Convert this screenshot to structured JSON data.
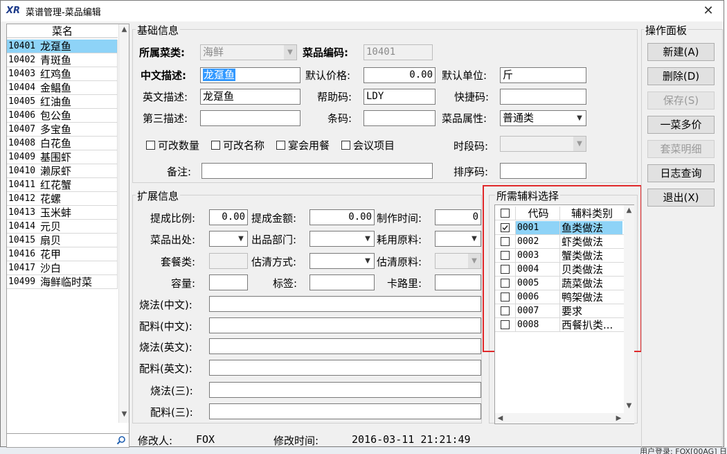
{
  "window": {
    "title": "菜谱管理-菜品编辑",
    "logo_text": "XR",
    "close_glyph": "✕"
  },
  "dish_list": {
    "header": "菜名",
    "rows": [
      {
        "code": "10401",
        "name": "龙趸鱼",
        "selected": true
      },
      {
        "code": "10402",
        "name": "青斑鱼"
      },
      {
        "code": "10403",
        "name": "红鸡鱼"
      },
      {
        "code": "10404",
        "name": "金鲳鱼"
      },
      {
        "code": "10405",
        "name": "红油鱼"
      },
      {
        "code": "10406",
        "name": "包公鱼"
      },
      {
        "code": "10407",
        "name": "多宝鱼"
      },
      {
        "code": "10408",
        "name": "白花鱼"
      },
      {
        "code": "10409",
        "name": "基围虾"
      },
      {
        "code": "10410",
        "name": "濑尿虾"
      },
      {
        "code": "10411",
        "name": "红花蟹"
      },
      {
        "code": "10412",
        "name": "花螺"
      },
      {
        "code": "10413",
        "name": "玉米蚌"
      },
      {
        "code": "10414",
        "name": "元贝"
      },
      {
        "code": "10415",
        "name": "扇贝"
      },
      {
        "code": "10416",
        "name": "花甲"
      },
      {
        "code": "10417",
        "name": "沙白"
      },
      {
        "code": "10499",
        "name": "海鲜临时菜"
      }
    ]
  },
  "basic": {
    "title": "基础信息",
    "category_label": "所属菜类:",
    "category_value": "海鲜",
    "dish_code_label": "菜品编码:",
    "dish_code_value": "10401",
    "cn_desc_label": "中文描述:",
    "cn_desc_value": "龙趸鱼",
    "price_label": "默认价格:",
    "price_value": "0.00",
    "unit_label": "默认单位:",
    "unit_value": "斤",
    "en_desc_label": "英文描述:",
    "en_desc_value": "龙趸鱼",
    "help_code_label": "帮助码:",
    "help_code_value": "LDY",
    "shortcut_label": "快捷码:",
    "shortcut_value": "",
    "third_desc_label": "第三描述:",
    "third_desc_value": "",
    "barcode_label": "条码:",
    "barcode_value": "",
    "attr_label": "菜品属性:",
    "attr_value": "普通类",
    "chk_qty": "可改数量",
    "chk_name": "可改名称",
    "chk_banquet": "宴会用餐",
    "chk_meeting": "会议项目",
    "period_label": "时段码:",
    "period_value": "",
    "note_label": "备注:",
    "note_value": "",
    "sort_label": "排序码:",
    "sort_value": ""
  },
  "ext": {
    "title": "扩展信息",
    "commission_ratio_label": "提成比例:",
    "commission_ratio_value": "0.00",
    "commission_amount_label": "提成金额:",
    "commission_amount_value": "0.00",
    "make_time_label": "制作时间:",
    "make_time_value": "0",
    "origin_label": "菜品出处:",
    "out_dept_label": "出品部门:",
    "material_label": "耗用原料:",
    "set_label": "套餐类:",
    "estimate_method_label": "估清方式:",
    "estimate_material_label": "估清原料:",
    "capacity_label": "容量:",
    "tag_label": "标签:",
    "calorie_label": "卡路里:",
    "cook_cn_label": "烧法(中文):",
    "ingr_cn_label": "配料(中文):",
    "cook_en_label": "烧法(英文):",
    "ingr_en_label": "配料(英文):",
    "cook_3_label": "烧法(三):",
    "ingr_3_label": "配料(三):"
  },
  "aux": {
    "title": "所需辅料选择",
    "col_code": "代码",
    "col_name": "辅料类别",
    "rows": [
      {
        "code": "0001",
        "name": "鱼类做法",
        "checked": true,
        "selected": true
      },
      {
        "code": "0002",
        "name": "虾类做法"
      },
      {
        "code": "0003",
        "name": "蟹类做法"
      },
      {
        "code": "0004",
        "name": "贝类做法"
      },
      {
        "code": "0005",
        "name": "蔬菜做法"
      },
      {
        "code": "0006",
        "name": "鸭架做法"
      },
      {
        "code": "0007",
        "name": "要求"
      },
      {
        "code": "0008",
        "name": "西餐扒类..."
      }
    ]
  },
  "actions": {
    "title": "操作面板",
    "new": "新建(A)",
    "delete": "删除(D)",
    "save": "保存(S)",
    "multi_price": "一菜多价",
    "set_detail": "套菜明细",
    "log": "日志查询",
    "exit": "退出(X)"
  },
  "footer": {
    "modifier_label": "修改人:",
    "modifier_value": "FOX",
    "time_label": "修改时间:",
    "time_value": "2016-03-11 21:21:49"
  },
  "bg_status": "用户登录: FOX[00AG] 日"
}
